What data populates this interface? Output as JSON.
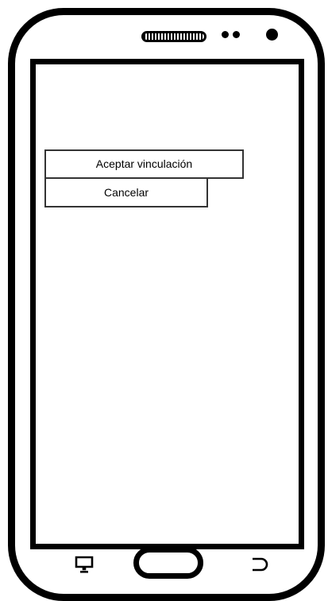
{
  "dialog": {
    "accept_label": "Aceptar vinculación",
    "cancel_label": "Cancelar"
  },
  "device": {
    "nav_icons": [
      "recent-apps-icon",
      "home-button",
      "back-icon"
    ]
  }
}
